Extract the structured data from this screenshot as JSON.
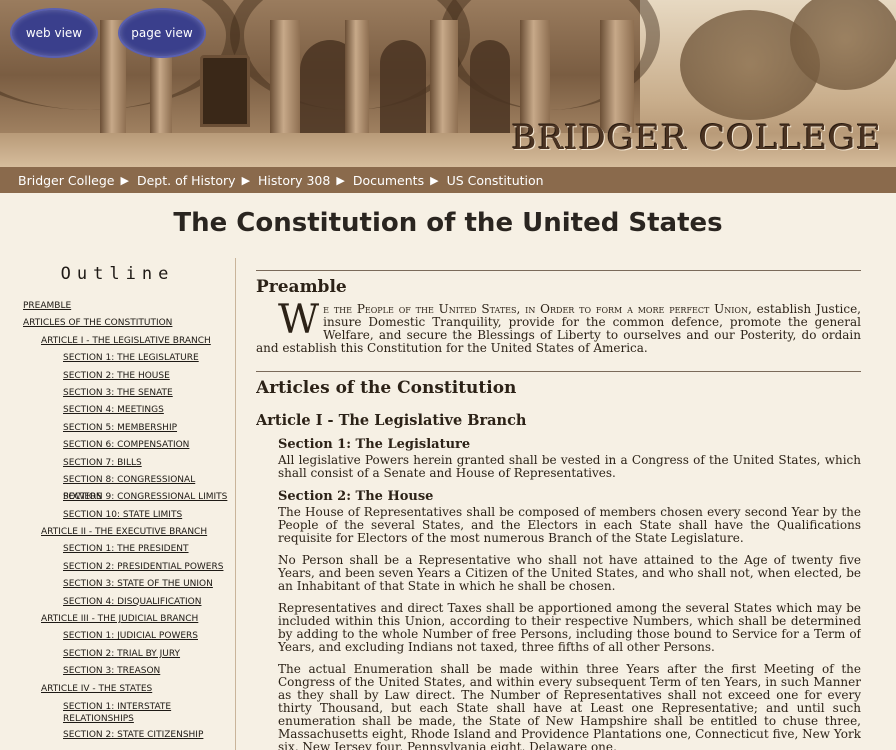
{
  "header": {
    "college_name": "BRIDGER COLLEGE",
    "web_view_label": "web view",
    "page_view_label": "page view"
  },
  "breadcrumb": [
    "Bridger College",
    "Dept. of History",
    "History 308",
    "Documents",
    "US Constitution"
  ],
  "page_title": "The Constitution of the United States",
  "outline": {
    "title": "Outline",
    "items": [
      {
        "label": "PREAMBLE",
        "level": 0
      },
      {
        "label": "ARTICLES OF THE CONSTITUTION",
        "level": 0
      },
      {
        "label": "ARTICLE I - THE LEGISLATIVE BRANCH",
        "level": 1
      },
      {
        "label": "SECTION 1: THE LEGISLATURE",
        "level": 2
      },
      {
        "label": "SECTION 2: THE HOUSE",
        "level": 2
      },
      {
        "label": "SECTION 3: THE SENATE",
        "level": 2
      },
      {
        "label": "SECTION 4: MEETINGS",
        "level": 2
      },
      {
        "label": "SECTION 5: MEMBERSHIP",
        "level": 2
      },
      {
        "label": "SECTION 6: COMPENSATION",
        "level": 2
      },
      {
        "label": "SECTION 7: BILLS",
        "level": 2
      },
      {
        "label": "SECTION 8: CONGRESSIONAL POWERS",
        "level": 2
      },
      {
        "label": "SECTION 9: CONGRESSIONAL LIMITS",
        "level": 2
      },
      {
        "label": "SECTION 10: STATE LIMITS",
        "level": 2
      },
      {
        "label": "ARTICLE II - THE EXECUTIVE BRANCH",
        "level": 1
      },
      {
        "label": "SECTION 1: THE PRESIDENT",
        "level": 2
      },
      {
        "label": "SECTION 2: PRESIDENTIAL POWERS",
        "level": 2
      },
      {
        "label": "SECTION 3: STATE OF THE UNION",
        "level": 2
      },
      {
        "label": "SECTION 4: DISQUALIFICATION",
        "level": 2
      },
      {
        "label": "ARTICLE III - THE JUDICIAL BRANCH",
        "level": 1
      },
      {
        "label": "SECTION 1: JUDICIAL POWERS",
        "level": 2
      },
      {
        "label": "SECTION 2: TRIAL BY JURY",
        "level": 2
      },
      {
        "label": "SECTION 3: TREASON",
        "level": 2
      },
      {
        "label": "ARTICLE IV - THE STATES",
        "level": 1
      },
      {
        "label": "SECTION 1: INTERSTATE RELATIONSHIPS",
        "level": 2,
        "wrap": true
      },
      {
        "label": "SECTION 2: STATE CITIZENSHIP",
        "level": 2
      }
    ]
  },
  "main": {
    "preamble_heading": "Preamble",
    "preamble_drop": "W",
    "preamble_smallcaps": "e the People of the United States, in Order to form a more perfect Union,",
    "preamble_rest": " establish Justice, insure Domestic Tranquility, provide for the common defence, promote the general Welfare, and secure the Blessings of Liberty to ourselves and our Posterity, do ordain and establish this Constitution for the United States of America.",
    "articles_heading": "Articles of the Constitution",
    "article1_heading": "Article I - The Legislative Branch",
    "sec1_heading": "Section 1: The Legislature",
    "sec1_text": "All legislative Powers herein granted shall be vested in a Congress of the United States, which shall consist of a Senate and House of Representatives.",
    "sec2_heading": "Section 2: The House",
    "sec2_p1": "The House of Representatives shall be composed of members chosen every second Year by the People of the several States, and the Electors in each State shall have the Qualifications requisite for Electors of the most numerous Branch of the State Legislature.",
    "sec2_p2": "No Person shall be a Representative who shall not have attained to the Age of twenty five Years, and been seven Years a Citizen of the United States, and who shall not, when elected, be an Inhabitant of that State in which he shall be chosen.",
    "sec2_p3": "Representatives and direct Taxes shall be apportioned among the several States which may be included within this Union, according to their respective Numbers, which shall be determined by adding to the whole Number of free Persons, including those bound to Service for a Term of Years, and excluding Indians not taxed, three fifths of all other Persons.",
    "sec2_p4": "The actual Enumeration shall be made within three Years after the first Meeting of the Congress of the United States, and within every subsequent Term of ten Years, in such Manner as they shall by Law direct. The Number of Representatives shall not exceed one for every thirty Thousand, but each State shall have at Least one Representative; and until such enumeration shall be made, the State of New Hampshire shall be entitled to chuse three, Massachusetts eight, Rhode Island and Providence Plantations one, Connecticut five, New York six, New Jersey four, Pennsylvania eight, Delaware one,"
  }
}
